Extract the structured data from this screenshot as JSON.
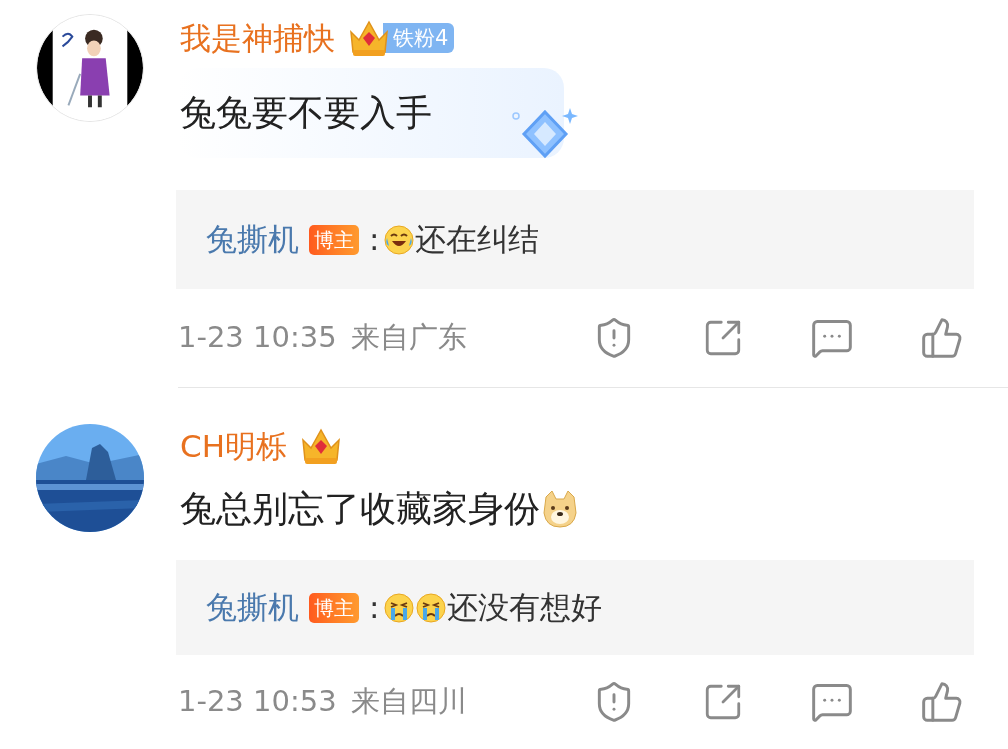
{
  "comments": [
    {
      "user": "我是神捕快",
      "badge": {
        "kind": "crown-label",
        "label": "铁粉4"
      },
      "text": "兔兔要不要入手",
      "bubble": true,
      "reply": {
        "author": "兔撕机",
        "author_badge": "博主",
        "separator": ":",
        "emojis": [
          {
            "kind": "laugh-cry"
          }
        ],
        "text": "还在纠结"
      },
      "time": "1-23 10:35",
      "location": "来自广东"
    },
    {
      "user": "CH明栎",
      "badge": {
        "kind": "crown"
      },
      "text": "兔总别忘了收藏家身份",
      "text_emojis": [
        {
          "kind": "doge"
        }
      ],
      "bubble": false,
      "reply": {
        "author": "兔撕机",
        "author_badge": "博主",
        "separator": ":",
        "emojis": [
          {
            "kind": "cry"
          },
          {
            "kind": "cry"
          }
        ],
        "text": "还没有想好"
      },
      "time": "1-23 10:53",
      "location": "来自四川"
    }
  ]
}
